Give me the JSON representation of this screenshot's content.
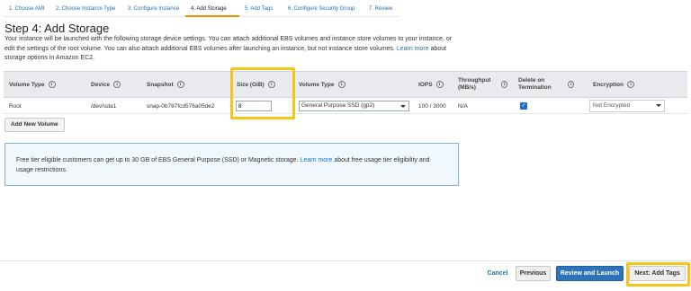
{
  "steps": [
    {
      "label": "1. Choose AMI"
    },
    {
      "label": "2. Choose Instance Type"
    },
    {
      "label": "3. Configure Instance"
    },
    {
      "label": "4. Add Storage"
    },
    {
      "label": "5. Add Tags"
    },
    {
      "label": "6. Configure Security Group"
    },
    {
      "label": "7. Review"
    }
  ],
  "page": {
    "title": "Step 4: Add Storage",
    "desc_text": "Your instance will be launched with the following storage device settings. You can attach additional EBS volumes and instance store volumes to your instance, or edit the settings of the root volume. You can also attach additional EBS volumes after launching an instance, but not instance store volumes.",
    "desc_link": "Learn more",
    "desc_tail": "about storage options in Amazon EC2."
  },
  "table": {
    "headers": {
      "volume_type": "Volume Type",
      "device": "Device",
      "snapshot": "Snapshot",
      "size": "Size (GiB)",
      "vol_type": "Volume Type",
      "iops": "IOPS",
      "throughput": "Throughput (MB/s)",
      "delete": "Delete on Termination",
      "encryption": "Encryption"
    },
    "row": {
      "volume_type": "Root",
      "device": "/dev/sda1",
      "snapshot": "snap-0b787fcd576a05de2",
      "size": "8",
      "vol_type": "General Purpose SSD (gp2)",
      "iops": "100 / 3000",
      "throughput": "N/A",
      "delete_checked": true,
      "encryption": "Not Encrypted"
    },
    "info_glyph": "i"
  },
  "add_volume_label": "Add New Volume",
  "notice": {
    "text": "Free tier eligible customers can get up to 30 GB of EBS General Purpose (SSD) or Magnetic storage.",
    "link": "Learn more",
    "tail": "about free usage tier eligibility and usage restrictions."
  },
  "footer": {
    "cancel": "Cancel",
    "previous": "Previous",
    "review": "Review and Launch",
    "next": "Next: Add Tags"
  },
  "colors": {
    "accent": "#1f6fb8",
    "highlight": "#f5c518",
    "primary_button": "#2e73b8"
  }
}
